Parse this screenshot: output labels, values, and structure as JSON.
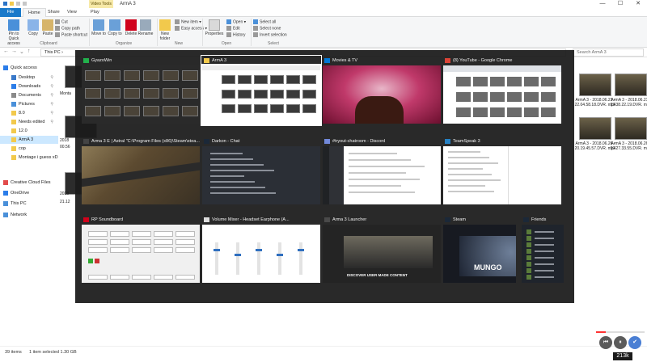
{
  "window": {
    "context_tab": "Video Tools",
    "title": "ArmA 3",
    "controls": {
      "minimize": "—",
      "maximize": "☐",
      "close": "✕"
    }
  },
  "ribbon": {
    "tabs": [
      "File",
      "Home",
      "Share",
      "View",
      "Play"
    ],
    "pin_label": "Pin to Quick access",
    "copy_label": "Copy",
    "paste_label": "Paste",
    "cut_label": "Cut",
    "copy_path_label": "Copy path",
    "paste_shortcut_label": "Paste shortcut",
    "move_to_label": "Move to",
    "copy_to_label": "Copy to",
    "delete_label": "Delete",
    "rename_label": "Rename",
    "new_folder_label": "New folder",
    "new_item_label": "New item",
    "easy_access_label": "Easy access",
    "properties_label": "Properties",
    "open_label": "Open",
    "edit_label": "Edit",
    "history_label": "History",
    "select_all_label": "Select all",
    "select_none_label": "Select none",
    "invert_selection_label": "Invert selection",
    "groups": [
      "Clipboard",
      "Organize",
      "New",
      "Open",
      "Select"
    ]
  },
  "address": {
    "path": "This PC  ›",
    "search_placeholder": "Search ArmA 3"
  },
  "navpane": {
    "items": [
      {
        "label": "Quick access",
        "pinned": false
      },
      {
        "label": "Desktop",
        "pinned": true
      },
      {
        "label": "Downloads",
        "pinned": true
      },
      {
        "label": "Documents",
        "pinned": true
      },
      {
        "label": "Pictures",
        "pinned": true
      },
      {
        "label": "8.0",
        "pinned": true
      },
      {
        "label": "Needs edited",
        "pinned": true
      },
      {
        "label": "12.0",
        "pinned": false
      },
      {
        "label": "ArmA 3",
        "pinned": false
      },
      {
        "label": "cop",
        "pinned": false
      },
      {
        "label": "Montage i guess xD",
        "pinned": false
      },
      {
        "label": "Creative Cloud Files",
        "pinned": false
      },
      {
        "label": "OneDrive",
        "pinned": false
      },
      {
        "label": "This PC",
        "pinned": false
      },
      {
        "label": "Network",
        "pinned": false
      }
    ]
  },
  "files": {
    "left_labels": [
      "Monta",
      "2018",
      "00.56",
      "2018",
      "21.12"
    ],
    "right": [
      {
        "name": "ArmA 3 - 2018.06.21 - 22.04.58.18.DVR. mp4"
      },
      {
        "name": "ArmA 3 - 2018.06.21 - 23.38.22.19.DVR. mp4"
      },
      {
        "name": "ArmA 3 - 2018.06.26 - 20.19.45.57.DVR. mp4"
      },
      {
        "name": "ArmA 3 - 2018.06.26 - 20.27.33.55.DVR. mp4"
      }
    ]
  },
  "switcher": {
    "rows": [
      [
        {
          "title": "GyazoWin",
          "icon": "gyazo-icon",
          "icon_color": "#22b14c",
          "kind": "thumbs"
        },
        {
          "title": "ArmA 3",
          "icon": "folder-icon",
          "icon_color": "#f2c94c",
          "kind": "explorer",
          "selected": true
        },
        {
          "title": "Movies & TV",
          "icon": "movie-icon",
          "icon_color": "#0078d7",
          "kind": "video"
        },
        {
          "title": "(8) YouTube - Google Chrome",
          "icon": "chrome-icon",
          "icon_color": "#db4437",
          "kind": "browser"
        }
      ],
      [
        {
          "title": "Arma 3 E | Astral \"C:\\Program Files (x86)\\Steam\\stea...",
          "icon": "console-icon",
          "icon_color": "#444444",
          "kind": "ruins"
        },
        {
          "title": "Darkon - Chat",
          "icon": "steam-chat-icon",
          "icon_color": "#1b2838",
          "kind": "chat"
        },
        {
          "title": "#tryout-chatroom - Discord",
          "icon": "discord-icon",
          "icon_color": "#7289da",
          "kind": "discord"
        },
        {
          "title": "TeamSpeak 3",
          "icon": "teamspeak-icon",
          "icon_color": "#2580c3",
          "kind": "teamspeak"
        }
      ],
      [
        {
          "title": "RP Soundboard",
          "icon": "soundboard-icon",
          "icon_color": "#d0021b",
          "kind": "soundboard"
        },
        {
          "title": "Volume Mixer - Headset Earphone (A...",
          "icon": "speaker-icon",
          "icon_color": "#dddddd",
          "kind": "mixer"
        },
        {
          "title": "Arma 3 Launcher",
          "icon": "arma-launcher-icon",
          "icon_color": "#4a4a4a",
          "kind": "launcher"
        },
        {
          "title": "Steam",
          "icon": "steam-icon",
          "icon_color": "#1b2838",
          "kind": "steam"
        },
        {
          "title": "Friends",
          "icon": "friends-icon",
          "icon_color": "#1b2838",
          "kind": "friends"
        }
      ]
    ],
    "launcher_text": "DISCOVER USER MADE CONTENT",
    "steam_text": "MUNGO"
  },
  "status": {
    "item_count": "39 items",
    "selection": "1 item selected  1.30 GB"
  },
  "player": {
    "badge": "213k",
    "progress": 0.2
  }
}
